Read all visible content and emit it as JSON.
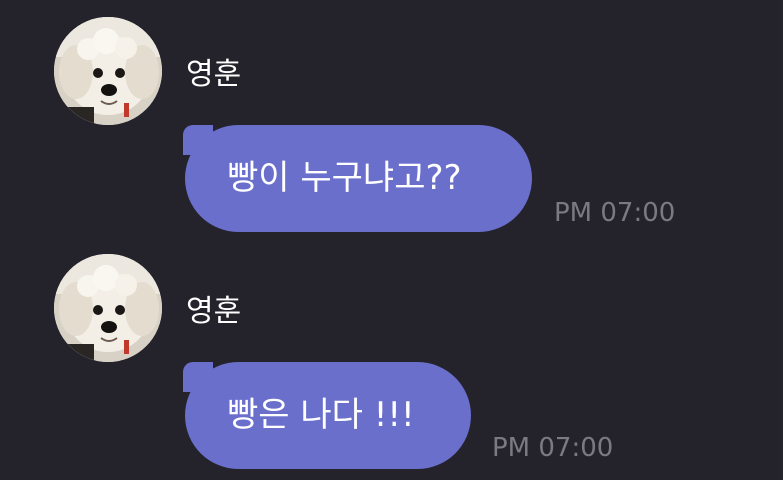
{
  "messages": [
    {
      "sender": "영훈",
      "avatar_icon": "puppy-avatar-icon",
      "text": "빵이 누구냐고??",
      "time": "PM 07:00"
    },
    {
      "sender": "영훈",
      "avatar_icon": "puppy-avatar-icon",
      "text": "빵은 나다 !!!",
      "time": "PM 07:00"
    }
  ],
  "colors": {
    "background": "#24232b",
    "bubble": "#6a6fcb",
    "text": "#ffffff",
    "timestamp": "#7b7a82"
  }
}
